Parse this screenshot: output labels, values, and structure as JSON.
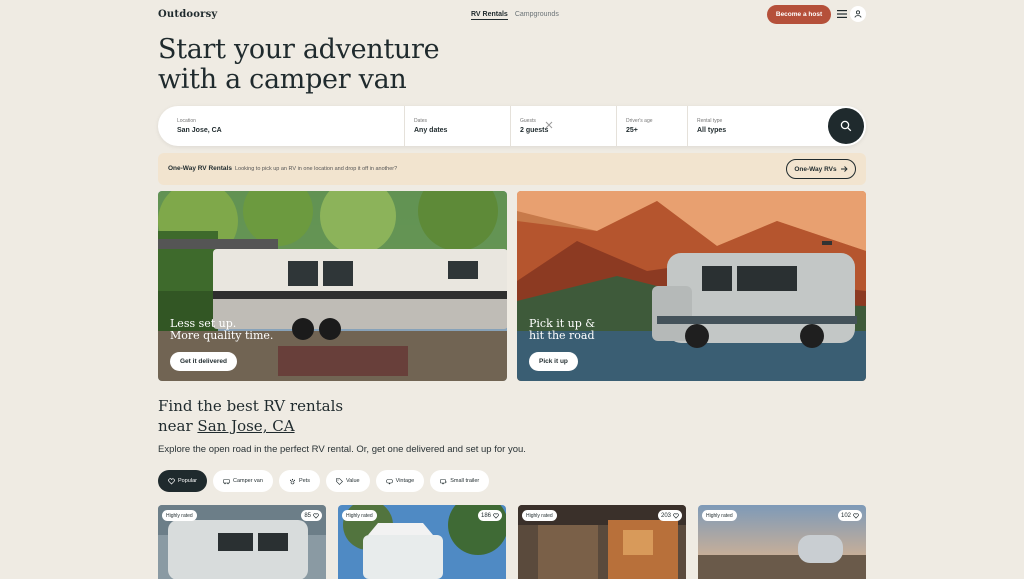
{
  "nav": {
    "logo": "Outdoorsy",
    "tabs": [
      {
        "label": "RV Rentals"
      },
      {
        "label": "Campgrounds"
      }
    ],
    "host_label": "Become a host"
  },
  "hero": {
    "title_line1": "Start your adventure",
    "title_line2": "with a camper van"
  },
  "search": {
    "location": {
      "label": "Location",
      "value": "San Jose, CA"
    },
    "dates": {
      "label": "Dates",
      "value": "Any dates"
    },
    "guests": {
      "label": "Guests",
      "value": "2 guests"
    },
    "age": {
      "label": "Driver's age",
      "value": "25+"
    },
    "type": {
      "label": "Rental type",
      "value": "All types"
    }
  },
  "oneway": {
    "title": "One-Way RV Rentals",
    "desc": "Looking to pick up an RV in one location and drop it off in another?",
    "button": "One-Way RVs"
  },
  "cards": [
    {
      "line1": "Less set up.",
      "line2": "More quality time.",
      "button": "Get it delivered"
    },
    {
      "line1": "Pick it up &",
      "line2": "hit the road",
      "button": "Pick it up"
    }
  ],
  "section": {
    "title_line1": "Find the best RV rentals",
    "title_prefix": "near ",
    "location": "San Jose, CA",
    "desc": "Explore the open road in the perfect RV rental. Or, get one delivered and set up for you."
  },
  "chips": [
    {
      "label": "Popular",
      "icon": "heart-icon"
    },
    {
      "label": "Camper van",
      "icon": "van-icon"
    },
    {
      "label": "Pets",
      "icon": "paw-icon"
    },
    {
      "label": "Value",
      "icon": "tag-icon"
    },
    {
      "label": "Vintage",
      "icon": "vintage-icon"
    },
    {
      "label": "Small trailer",
      "icon": "trailer-icon"
    }
  ],
  "listings": [
    {
      "badge": "Highly rated",
      "likes": "85"
    },
    {
      "badge": "Highly rated",
      "likes": "186"
    },
    {
      "badge": "Highly rated",
      "likes": "203"
    },
    {
      "badge": "Highly rated",
      "likes": "102"
    }
  ],
  "colors": {
    "accent": "#b5503a",
    "dark": "#1f2a2d",
    "background": "#efebe3",
    "banner": "#f2e4cf"
  }
}
